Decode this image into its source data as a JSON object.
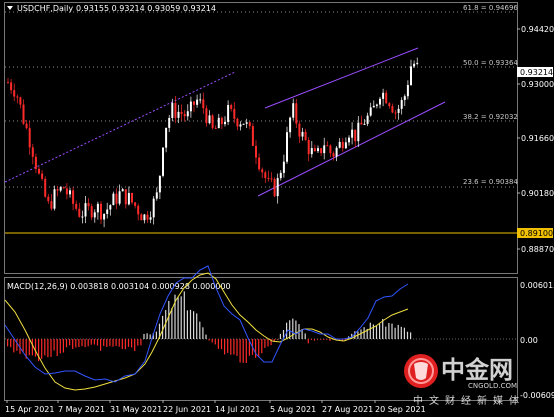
{
  "header": {
    "symbol_label": "USDCHF,Daily",
    "ohlc": "0.93155 0.93214 0.93059 0.93214"
  },
  "price_axis": {
    "ticks": [
      "0.94420",
      "0.93000",
      "0.91660",
      "0.90180",
      "0.88870"
    ],
    "highlight": "0.89100",
    "current": "0.93214"
  },
  "fib_levels": [
    {
      "label": "61.8 = 0.94696"
    },
    {
      "label": "50.0 = 0.93364"
    },
    {
      "label": "38.2 = 0.92032"
    },
    {
      "label": "23.6 = 0.90384"
    }
  ],
  "macd": {
    "label": "MACD(12,26,9) 0.003818 0.003104 0.000928 0.000000",
    "ticks": [
      "0.006015",
      "0.00",
      "-0.006092"
    ]
  },
  "time_axis": {
    "labels": [
      "15 Apr 2021",
      "7 May 2021",
      "31 May 2021",
      "22 Jun 2021",
      "14 Jul 2021",
      "5 Aug 2021",
      "27 Aug 2021",
      "20 Sep 2021"
    ]
  },
  "watermark": {
    "brand": "中金网",
    "domain": "CNGOLD.COM",
    "slogan": "中文财经新媒体"
  },
  "colors": {
    "bull": "#ffffff",
    "bear": "#ff2a2a",
    "channel": "#9b4dff",
    "highlight_line": "#f0c000",
    "macd_signal": "#f0e040",
    "macd_line": "#3355ff"
  },
  "chart_data": {
    "type": "candlestick",
    "symbol": "USDCHF",
    "timeframe": "Daily",
    "last_ohlc": {
      "open": 0.93155,
      "high": 0.93214,
      "low": 0.93059,
      "close": 0.93214
    },
    "ylim": [
      0.8845,
      0.9475
    ],
    "close_path": [
      [
        0,
        0.929
      ],
      [
        8,
        0.927
      ],
      [
        16,
        0.92
      ],
      [
        24,
        0.914
      ],
      [
        32,
        0.906
      ],
      [
        40,
        0.9
      ],
      [
        48,
        0.903
      ],
      [
        56,
        0.9045
      ],
      [
        64,
        0.901
      ],
      [
        72,
        0.8985
      ],
      [
        80,
        0.899
      ],
      [
        88,
        0.9
      ],
      [
        96,
        0.8985
      ],
      [
        104,
        0.901
      ],
      [
        112,
        0.903
      ],
      [
        120,
        0.902
      ],
      [
        128,
        0.9
      ],
      [
        136,
        0.8975
      ],
      [
        144,
        0.9
      ],
      [
        150,
        0.903
      ],
      [
        156,
        0.918
      ],
      [
        164,
        0.9225
      ],
      [
        172,
        0.922
      ],
      [
        180,
        0.921
      ],
      [
        188,
        0.925
      ],
      [
        196,
        0.923
      ],
      [
        204,
        0.9175
      ],
      [
        212,
        0.919
      ],
      [
        220,
        0.922
      ],
      [
        228,
        0.9205
      ],
      [
        236,
        0.92
      ],
      [
        244,
        0.916
      ],
      [
        252,
        0.91
      ],
      [
        260,
        0.905
      ],
      [
        268,
        0.904
      ],
      [
        276,
        0.912
      ],
      [
        284,
        0.923
      ],
      [
        292,
        0.9175
      ],
      [
        300,
        0.914
      ],
      [
        308,
        0.911
      ],
      [
        316,
        0.915
      ],
      [
        324,
        0.912
      ],
      [
        332,
        0.9145
      ],
      [
        340,
        0.918
      ],
      [
        348,
        0.9165
      ],
      [
        356,
        0.92
      ],
      [
        364,
        0.9215
      ],
      [
        372,
        0.927
      ],
      [
        380,
        0.9255
      ],
      [
        388,
        0.922
      ],
      [
        396,
        0.925
      ],
      [
        404,
        0.934
      ],
      [
        410,
        0.9321
      ]
    ],
    "fibonacci": [
      {
        "level": 61.8,
        "price": 0.94696
      },
      {
        "level": 50.0,
        "price": 0.93364
      },
      {
        "level": 38.2,
        "price": 0.92032
      },
      {
        "level": 23.6,
        "price": 0.90384
      }
    ],
    "support_line": 0.891,
    "macd": {
      "params": [
        12,
        26,
        9
      ],
      "values": {
        "macd": 0.003818,
        "signal": 0.003104,
        "histogram": 0.000928
      },
      "ylim": [
        -0.006092,
        0.006015
      ]
    }
  }
}
